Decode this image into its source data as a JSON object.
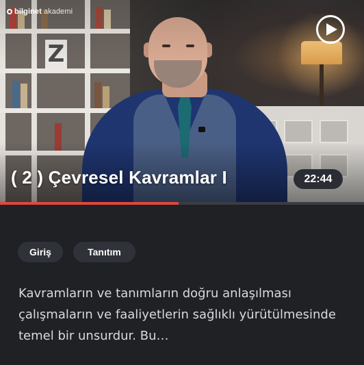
{
  "brand": {
    "name": "bilginet",
    "sub": "akademi"
  },
  "video": {
    "title": "( 2 ) Çevresel Kavramlar I",
    "duration": "22:44",
    "progress": 0.49,
    "play_icon": "play-icon",
    "poster_letter": "Z"
  },
  "tags": [
    "Giriş",
    "Tanıtım"
  ],
  "description": "Kavramların ve tanımların doğru anlaşılması çalışmaların ve faaliyetlerin sağlıklı yürütülmesinde temel bir unsurdur. Bu…",
  "colors": {
    "accent": "#e0473c",
    "background": "#1f2125",
    "tag_bg": "#2f3238"
  }
}
